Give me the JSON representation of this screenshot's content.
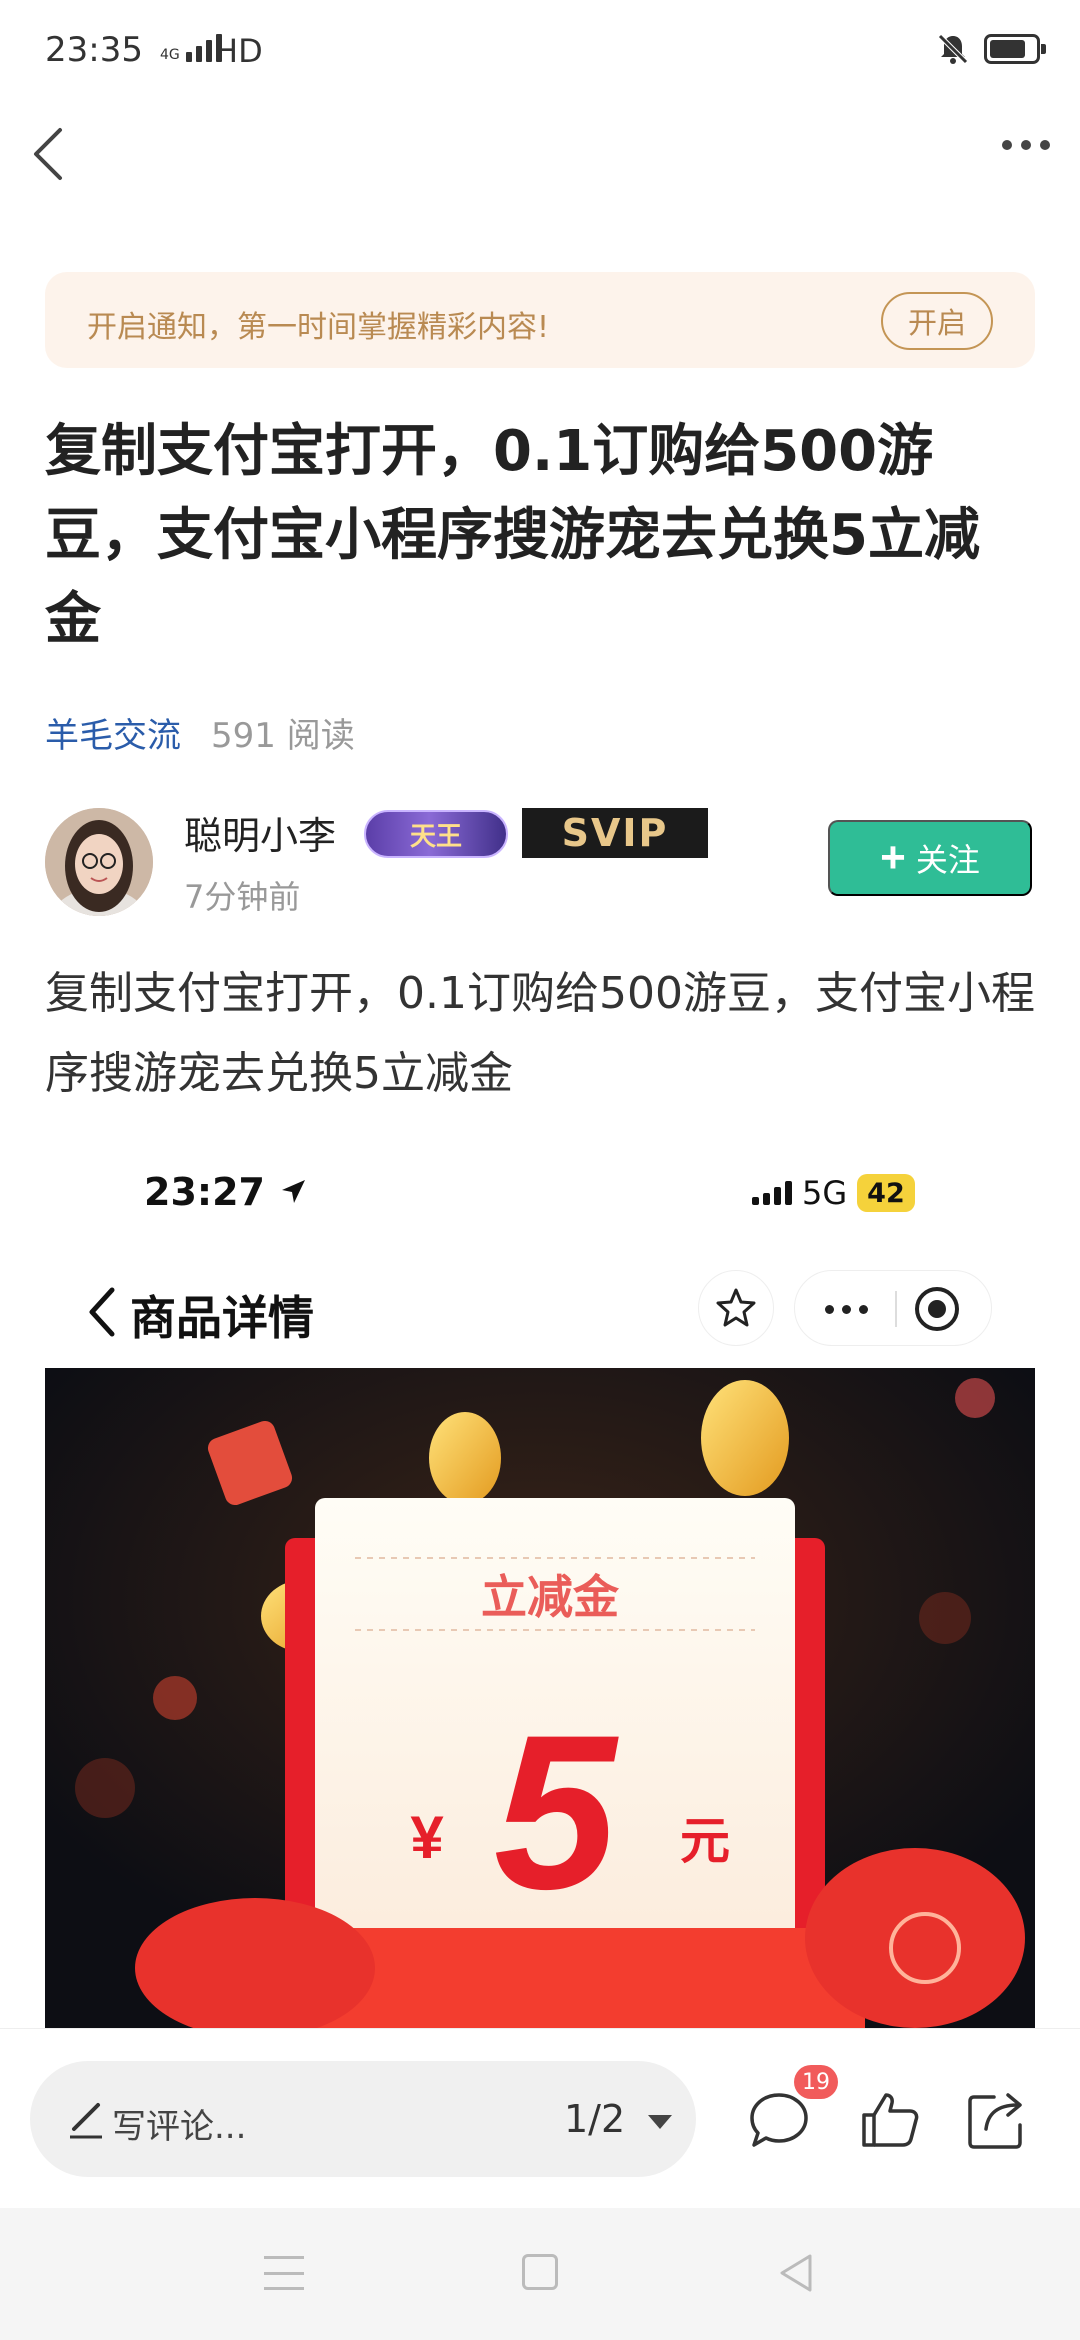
{
  "status_bar": {
    "time": "23:35",
    "network": "4G",
    "hd": "HD"
  },
  "notice": {
    "text": "开启通知，第一时间掌握精彩内容!",
    "button": "开启"
  },
  "article": {
    "title": "复制支付宝打开，0.1订购给500游豆，支付宝小程序搜游宠去兑换5立减金",
    "category": "羊毛交流",
    "reads": "591 阅读",
    "body": "复制支付宝打开，0.1订购给500游豆，支付宝小程序搜游宠去兑换5立减金"
  },
  "author": {
    "name": "聪明小李",
    "badge_king": "天王",
    "badge_svip": "SVIP",
    "time": "7分钟前",
    "follow_label": "关注"
  },
  "embedded_screenshot": {
    "time": "23:27",
    "network": "5G",
    "battery": "42",
    "page_title": "商品详情",
    "promo": {
      "heading": "立减金",
      "currency": "¥",
      "amount": "5",
      "unit": "元"
    }
  },
  "bottom_bar": {
    "comment_placeholder": "写评论...",
    "page_indicator": "1/2",
    "comment_count": "19"
  },
  "colors": {
    "accent": "#2fbd96",
    "link": "#2a5caa",
    "notice_bg": "#fdf3eb",
    "badge_red": "#f15b5b"
  }
}
